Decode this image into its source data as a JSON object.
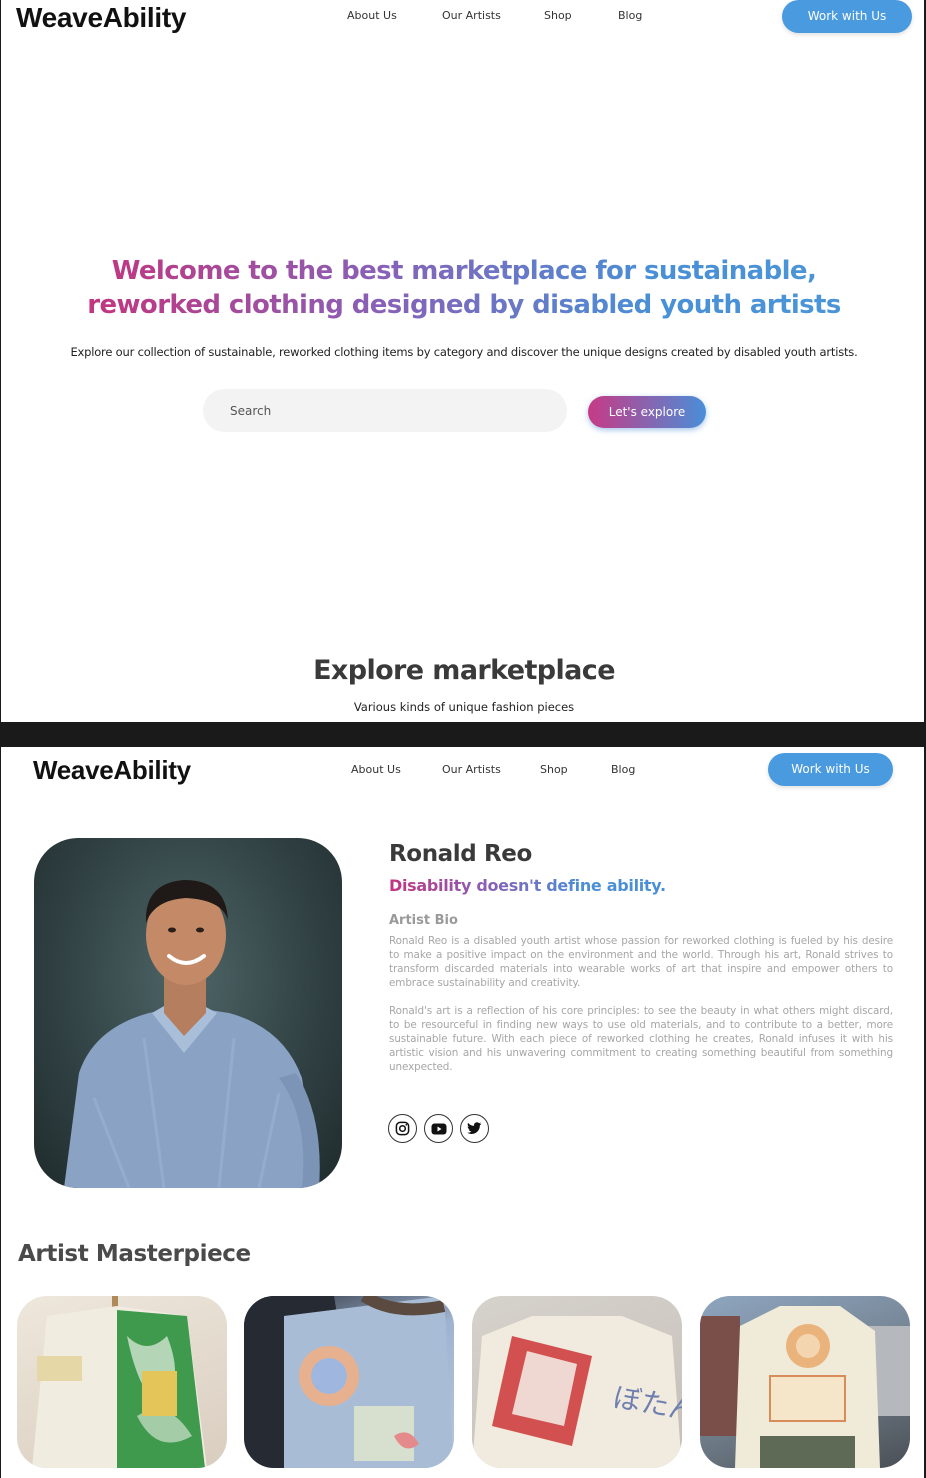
{
  "brand": "WeaveAbility",
  "nav": {
    "items": [
      "About Us",
      "Our Artists",
      "Shop",
      "Blog"
    ],
    "cta": "Work with Us"
  },
  "hero": {
    "title_line1": "Welcome to the best marketplace for sustainable,",
    "title_line2": "reworked clothing designed by disabled youth artists",
    "subtitle": "Explore our collection of sustainable, reworked clothing items by category and discover the unique designs created by disabled youth artists.",
    "search_placeholder": "Search",
    "explore_button": "Let's explore"
  },
  "marketplace": {
    "title": "Explore marketplace",
    "subtitle": "Various kinds of unique fashion pieces"
  },
  "artist": {
    "name": "Ronald Reo",
    "tagline": "Disability doesn't define ability.",
    "bio_heading": "Artist Bio",
    "bio_paragraph_1": "Ronald Reo is a disabled youth artist whose passion for reworked clothing is fueled by his desire to make a positive impact on the environment and the world. Through his art, Ronald strives to transform discarded materials into wearable works of art that inspire and empower others to embrace sustainability and creativity.",
    "bio_paragraph_2": "Ronald's art is a reflection of his core principles: to see the beauty in what others might discard, to be resourceful in finding new ways to use old materials, and to contribute to a better, more sustainable future. With each piece of reworked clothing he creates, Ronald infuses it with his artistic vision and his unwavering commitment to creating something beautiful from something unexpected.",
    "social_icons": [
      "instagram-icon",
      "youtube-icon",
      "twitter-icon"
    ]
  },
  "masterpiece": {
    "title": "Artist Masterpiece",
    "items": [
      "patchwork-shirt",
      "embroidered-jeans",
      "printed-jacket",
      "flour-sack-shirt"
    ]
  },
  "colors": {
    "accent_blue": "#4a9ae0",
    "gradient_pink": "#c2357f",
    "gradient_blue": "#4a8fd6"
  }
}
